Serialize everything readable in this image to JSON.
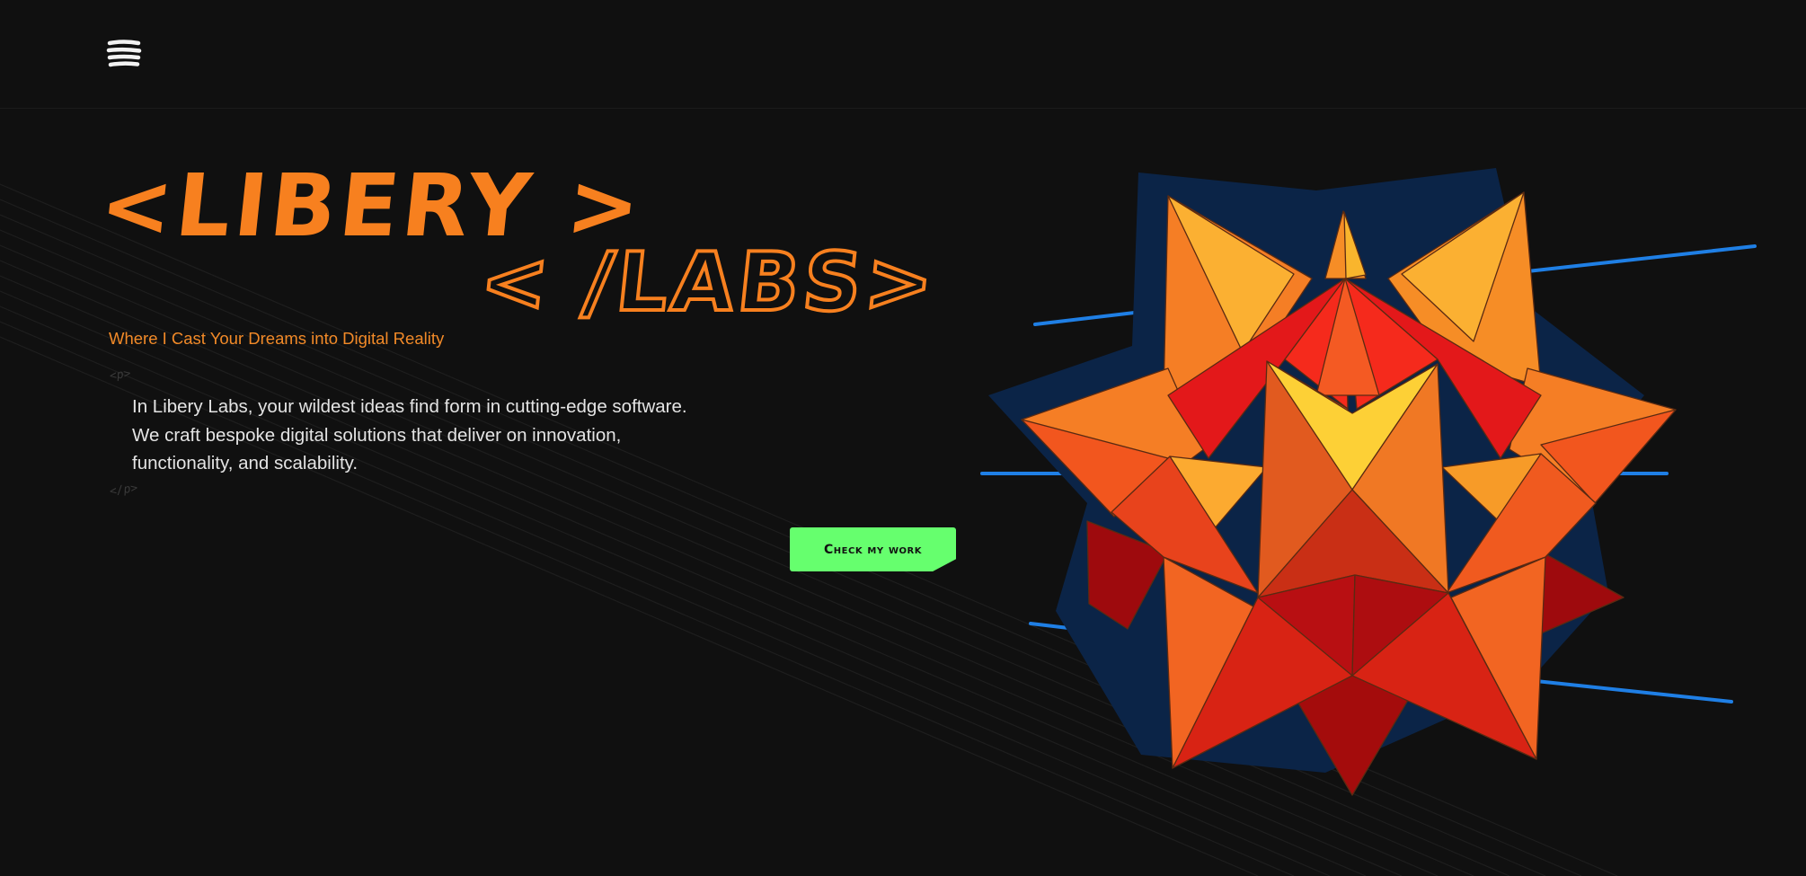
{
  "nav": {
    "menu_icon": "hamburger-menu-icon"
  },
  "hero": {
    "logo_line1": "<LIBERY >",
    "logo_line2": "< /LABS>",
    "tagline": "Where I Cast Your Dreams into Digital Reality",
    "code_open": "<p>",
    "code_close": "</p>",
    "intro_lines": [
      "In Libery Labs, your wildest ideas find form in cutting-edge software.",
      "We craft bespoke digital solutions that deliver on innovation,",
      "functionality, and scalability."
    ],
    "cta_label": "Check my work"
  },
  "colors": {
    "background": "#101010",
    "accent_orange": "#f7801f",
    "cta_green": "#66ff6e",
    "laser_blue": "#1f7fe5",
    "star_shadow": "#0b2447"
  },
  "illustration": {
    "icon": "polyhedron-star-icon"
  }
}
